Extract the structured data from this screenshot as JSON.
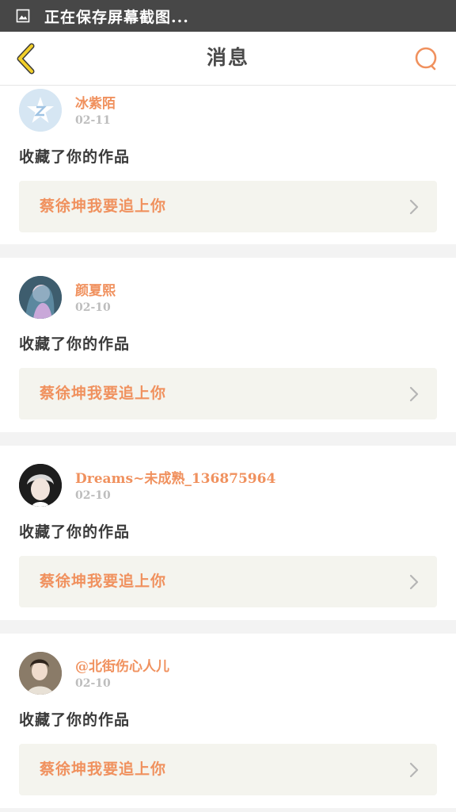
{
  "status_bar": {
    "text": "正在保存屏幕截图..."
  },
  "header": {
    "title": "消息"
  },
  "colors": {
    "accent": "#f0915e",
    "back_arrow": "#f2cf2a",
    "status_bar": "#474747"
  },
  "notifications": [
    {
      "username": "冰紫陌",
      "date": "02-11",
      "action": "收藏了你的作品",
      "work_title": "蔡徐坤我要追上你"
    },
    {
      "username": "颜夏熙",
      "date": "02-10",
      "action": "收藏了你的作品",
      "work_title": "蔡徐坤我要追上你"
    },
    {
      "username": "Dreams~未成熟_136875964",
      "date": "02-10",
      "action": "收藏了你的作品",
      "work_title": "蔡徐坤我要追上你"
    },
    {
      "username": "@北街伤心人儿",
      "date": "02-10",
      "action": "收藏了你的作品",
      "work_title": "蔡徐坤我要追上你"
    }
  ]
}
